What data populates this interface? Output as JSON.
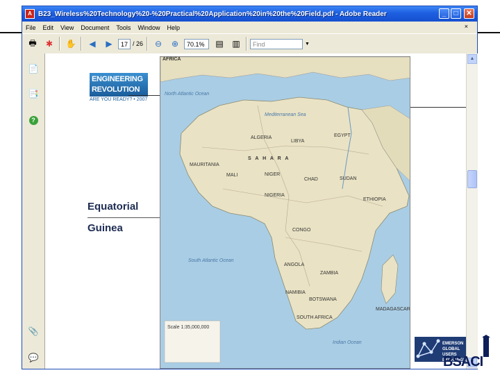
{
  "window": {
    "title": "B23_Wireless%20Technology%20-%20Practical%20Application%20in%20the%20Field.pdf - Adobe Reader",
    "min_label": "_",
    "max_label": "□",
    "close_label": "✕"
  },
  "menu": {
    "items": [
      "File",
      "Edit",
      "View",
      "Document",
      "Tools",
      "Window",
      "Help"
    ],
    "close_glyph": "×"
  },
  "toolbar": {
    "page_value": "17",
    "page_total": "/ 26",
    "zoom_value": "70.1%",
    "find_placeholder": "Find"
  },
  "slide": {
    "logo_line1": "ENGINEERING",
    "logo_line2": "REVOLUTION",
    "logo_tagline": "ARE YOU READY? • 2007",
    "label_line1": "Equatorial",
    "label_line2": "Guinea",
    "emerson_line1": "EMERSON",
    "emerson_line2": "GLOBAL",
    "emerson_line3": "USERS",
    "emerson_line4": "EXCHANGE",
    "corner_text": "BSACI"
  },
  "map": {
    "title": "AFRICA",
    "labels": {
      "algeria": "ALGERIA",
      "libya": "LIBYA",
      "egypt": "EGYPT",
      "sahara": "S A H A R A",
      "mauritania": "MAURITANIA",
      "mali": "MALI",
      "niger": "NIGER",
      "chad": "CHAD",
      "sudan": "SUDAN",
      "nigeria": "NIGERIA",
      "ethiopia": "ETHIOPIA",
      "congo": "CONGO",
      "angola": "ANGOLA",
      "zambia": "ZAMBIA",
      "namibia": "NAMIBIA",
      "botswana": "BOTSWANA",
      "south_africa": "SOUTH AFRICA",
      "madagascar": "MADAGASCAR",
      "mediterranean": "Mediterranean Sea",
      "atlantic": "North Atlantic Ocean",
      "south_atlantic": "South Atlantic Ocean",
      "indian": "Indian Ocean",
      "scale": "Scale 1:35,000,000"
    }
  },
  "colors": {
    "titlebar": "#1c5fe0",
    "chrome": "#ece9d8",
    "land": "#e9e2c4",
    "water": "#a9cde4",
    "label": "#1d2c52"
  }
}
